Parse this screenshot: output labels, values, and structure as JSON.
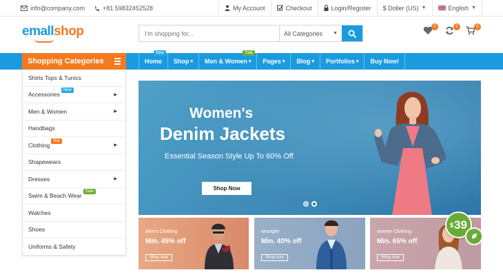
{
  "topbar": {
    "email": "info@company.com",
    "phone": "+81 59832452528",
    "my_account": "My Account",
    "checkout": "Checkout",
    "login": "Login/Register",
    "currency": "$ Doller (US)",
    "language": "English"
  },
  "header": {
    "logo_part1": "emall",
    "logo_part2": "shop",
    "search_placeholder": "I'm shopping for...",
    "category_select": "All Categories",
    "wishlist_count": "0",
    "compare_count": "0",
    "cart_count": "0"
  },
  "categories": {
    "title": "Shopping Categories",
    "items": [
      {
        "label": "Shirts Tops & Tunics",
        "arrow": false,
        "tag": ""
      },
      {
        "label": "Accessories",
        "arrow": true,
        "tag": "New"
      },
      {
        "label": "Men & Women",
        "arrow": true,
        "tag": ""
      },
      {
        "label": "Handbags",
        "arrow": false,
        "tag": ""
      },
      {
        "label": "Clothing",
        "arrow": true,
        "tag": "Hot"
      },
      {
        "label": "Shapewears",
        "arrow": false,
        "tag": ""
      },
      {
        "label": "Dresses",
        "arrow": true,
        "tag": ""
      },
      {
        "label": "Swim & Beach Wear",
        "arrow": false,
        "tag": "Sale"
      },
      {
        "label": "Watches",
        "arrow": false,
        "tag": ""
      },
      {
        "label": "Shoes",
        "arrow": false,
        "tag": ""
      },
      {
        "label": "Uniforms & Safety",
        "arrow": false,
        "tag": ""
      }
    ]
  },
  "nav": {
    "items": [
      {
        "label": "Home",
        "tag": "New"
      },
      {
        "label": "Shop",
        "tag": ""
      },
      {
        "label": "Men & Women",
        "tag": "Sale"
      },
      {
        "label": "Pages",
        "tag": ""
      },
      {
        "label": "Blog",
        "tag": ""
      },
      {
        "label": "Portfolios",
        "tag": ""
      },
      {
        "label": "Buy Now!",
        "tag": ""
      }
    ]
  },
  "banner": {
    "line1": "Women's",
    "line2": "Denim Jackets",
    "line3": "Essential Season Style Up To 60% Off",
    "button": "Shop Now"
  },
  "promos": [
    {
      "title": "Men's Clothing",
      "discount": "Min. 45% off",
      "button": "Shop now"
    },
    {
      "title": "wrangler",
      "discount": "Min. 40% off",
      "button": "Shop now"
    },
    {
      "title": "women Clothing",
      "discount": "Min. 65% off",
      "button": "Shop now"
    }
  ],
  "price_badge": {
    "currency": "$",
    "amount": "39"
  },
  "colors": {
    "primary": "#1a9be0",
    "accent": "#f47a1f",
    "new": "#29a8e0",
    "hot": "#f47a1f",
    "sale": "#6aab36"
  }
}
